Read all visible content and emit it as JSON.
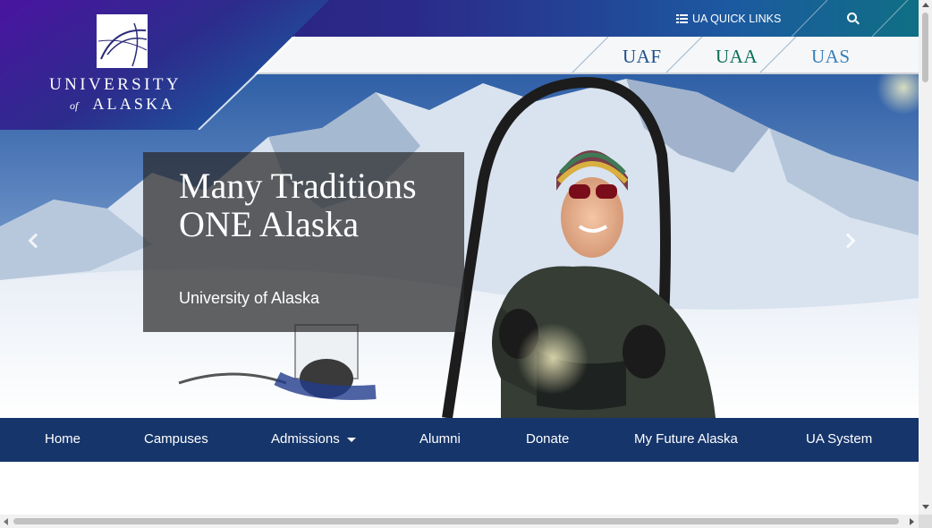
{
  "header": {
    "quick_links_label": "UA QUICK LINKS",
    "list_icon": "list-icon",
    "search_icon": "search-icon"
  },
  "logo": {
    "line1": "UNIVERSITY",
    "of": "of",
    "line2": "ALASKA"
  },
  "campuses": [
    {
      "label": "UAF",
      "color": "#1f4f8a"
    },
    {
      "label": "UAA",
      "color": "#0b6e56"
    },
    {
      "label": "UAS",
      "color": "#3a7fb8"
    }
  ],
  "hero": {
    "title": "Many Traditions ONE Alaska",
    "subtitle": "University of Alaska",
    "prev_icon": "chevron-left-icon",
    "next_icon": "chevron-right-icon"
  },
  "nav": {
    "items": [
      {
        "label": "Home"
      },
      {
        "label": "Campuses"
      },
      {
        "label": "Admissions",
        "dropdown": true
      },
      {
        "label": "Alumni"
      },
      {
        "label": "Donate"
      },
      {
        "label": "My Future Alaska"
      },
      {
        "label": "UA System"
      }
    ]
  },
  "colors": {
    "topbar_start": "#2a1c78",
    "topbar_end": "#0f6f84",
    "nav_bg": "#16356b"
  }
}
